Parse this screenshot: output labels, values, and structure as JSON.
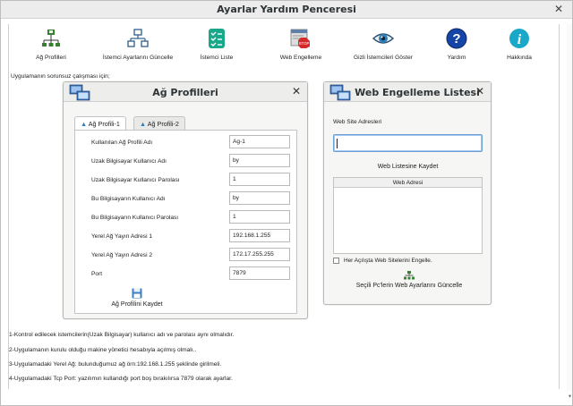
{
  "window": {
    "title": "Ayarlar Yardım Penceresi",
    "close": "✕"
  },
  "toolbar": {
    "items": [
      {
        "label": "Ağ Profilleri",
        "icon": "network-profile-icon"
      },
      {
        "label": "İstemci Ayarlarını Güncelle",
        "icon": "network-diagram-icon"
      },
      {
        "label": "İstemci Liste",
        "icon": "checklist-icon"
      },
      {
        "label": "Web Engelleme",
        "icon": "web-stop-icon"
      },
      {
        "label": "Gizli İstemcileri Göster",
        "icon": "eye-icon"
      },
      {
        "label": "Yardım",
        "icon": "help-icon"
      },
      {
        "label": "Hakkında",
        "icon": "info-icon"
      }
    ]
  },
  "top_note": "Uygulamanın sorunsuz çalışması için;",
  "profiles_panel": {
    "title": "Ağ Profilleri",
    "close": "✕",
    "tabs": [
      "Ağ Profili-1",
      "Ağ Profili-2"
    ],
    "fields": [
      {
        "label": "Kullanılan Ağ Profili  Adı",
        "value": "Ag-1"
      },
      {
        "label": "Uzak Bilgisayar Kullanıcı Adı",
        "value": "by"
      },
      {
        "label": "Uzak Bilgisayar Kullanıcı Parolası",
        "value": "1"
      },
      {
        "label": "Bu Bilgisayarın Kullanıcı Adı",
        "value": "by"
      },
      {
        "label": "Bu Bilgisayarın Kullanıcı Parolası",
        "value": "1"
      },
      {
        "label": "Yerel Ağ Yayın Adresi 1",
        "value": "192.168.1.255"
      },
      {
        "label": "Yerel Ağ Yayın Adresi 2",
        "value": "172.17.255.255"
      },
      {
        "label": "Port",
        "value": "7879"
      }
    ],
    "save_label": "Ağ Profilini Kaydet"
  },
  "web_panel": {
    "title": "Web Engelleme Listesi",
    "close": "✕",
    "site_label": "Web Site Adresleri",
    "site_input_value": "",
    "save_button": "Web Listesine Kaydet",
    "table_header": "Web Adresi",
    "checkbox_label": "Her Açılışta Web Sitelerini Engelle.",
    "checkbox_checked": false,
    "update_button": "Seçili Pc'lerin Web Ayarlarını Güncelle"
  },
  "notes": [
    "1-Kontrol edilecek istemcilerin(Uzak Bilgisayar) kullanıcı adı ve parolası aynı olmalıdır.",
    "2-Uygulamanın kurulu olduğu makine yönetici hesabıyla açılmış olmalı..",
    "3-Uygulamadaki Yerel Ağ: bulunduğumuz ağ örn:192.168.1.255 şeklinde girilmeli.",
    "4-Uygulamadaki Tcp Port: yazılımın kullandığı port boş bırakılırsa 7879 olarak ayarlar."
  ],
  "colors": {
    "accent": "#6d9dd7",
    "panel_bg": "#f6f6f5",
    "window_bg": "#ffffff"
  }
}
